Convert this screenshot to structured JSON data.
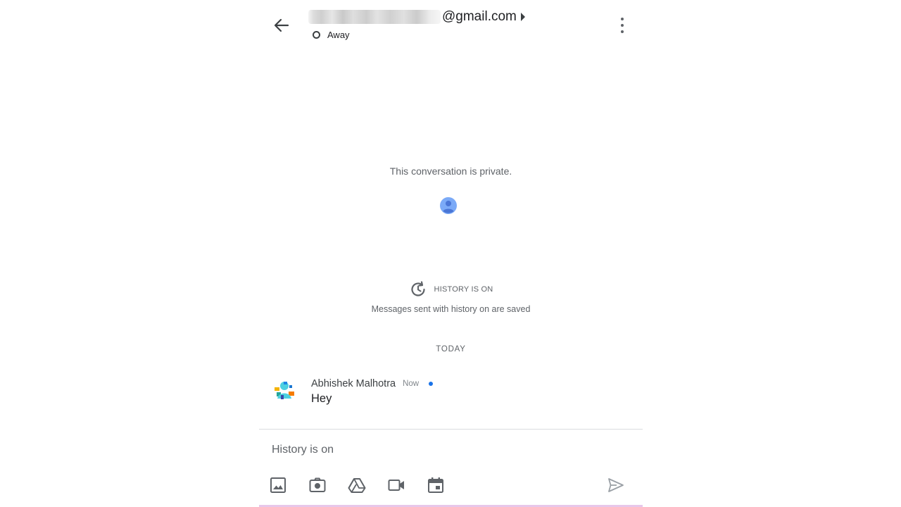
{
  "header": {
    "email_suffix": "@gmail.com",
    "status": "Away"
  },
  "conversation": {
    "private_notice": "This conversation is private.",
    "history_title": "HISTORY IS ON",
    "history_subtitle": "Messages sent with history on are saved",
    "date_divider": "TODAY"
  },
  "messages": [
    {
      "sender": "Abhishek Malhotra",
      "time": "Now",
      "text": "Hey",
      "unread": true
    }
  ],
  "composer": {
    "placeholder": "History is on",
    "tools": [
      "image-icon",
      "camera-icon",
      "drive-icon",
      "video-icon",
      "calendar-icon"
    ],
    "send_icon": "send-icon"
  },
  "colors": {
    "accent": "#1a73e8",
    "avatar": "#7baaf7",
    "icon": "#5f6368"
  }
}
